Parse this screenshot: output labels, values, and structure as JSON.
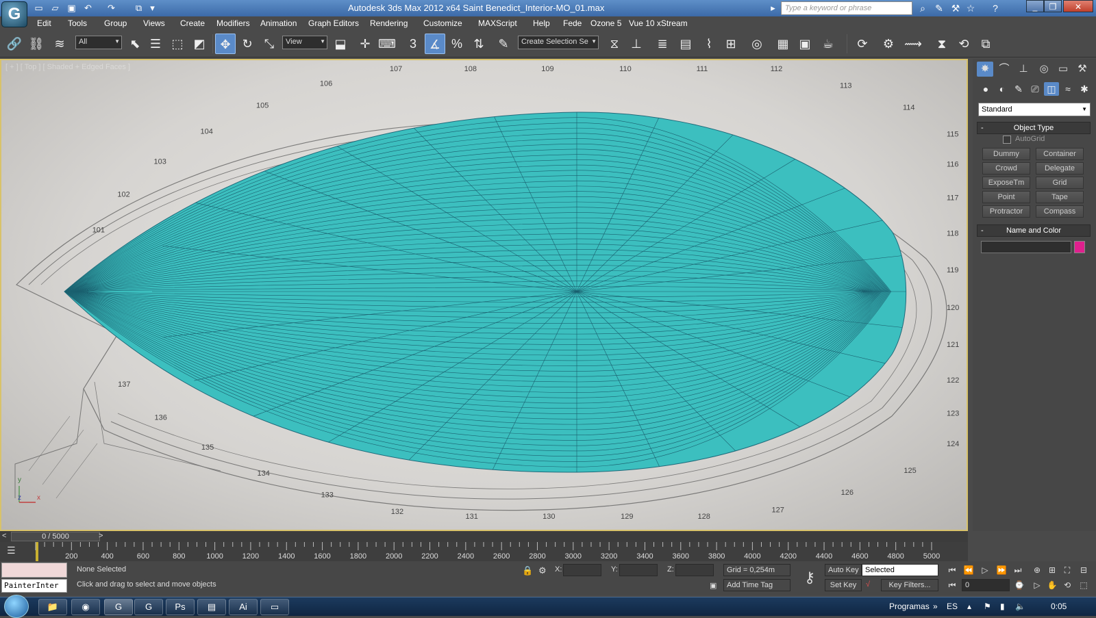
{
  "titlebar": {
    "title": "Autodesk 3ds Max  2012 x64     Saint Benedict_Interior-MO_01.max",
    "search_placeholder": "Type a keyword or phrase"
  },
  "menu": [
    "Edit",
    "Tools",
    "Group",
    "Views",
    "Create",
    "Modifiers",
    "Animation",
    "Graph Editors",
    "Rendering",
    "Customize",
    "MAXScript",
    "Help",
    "Fede",
    "Ozone 5",
    "Vue 10 xStream"
  ],
  "toolbar": {
    "selection_filter": "All",
    "ref_coord": "View",
    "named_selection": "Create Selection Se",
    "snap_label": "3"
  },
  "viewport": {
    "label": "[ + ] [ Top ] [ Shaded + Edged Faces ]",
    "axis_x": "x",
    "axis_y": "y",
    "axis_z": "z",
    "drawing_numbers": [
      "101",
      "102",
      "103",
      "104",
      "105",
      "106",
      "107",
      "108",
      "109",
      "110",
      "111",
      "112",
      "113",
      "114",
      "115",
      "116",
      "117",
      "118",
      "119",
      "120",
      "121",
      "122",
      "123",
      "124",
      "125",
      "126",
      "127",
      "128",
      "129",
      "130",
      "131",
      "132",
      "133",
      "134",
      "135",
      "136",
      "137"
    ],
    "mesh_color": "#3cbfbf"
  },
  "command_panel": {
    "category": "Standard",
    "object_type_title": "Object Type",
    "autogrid_label": "AutoGrid",
    "buttons": [
      "Dummy",
      "Container",
      "Crowd",
      "Delegate",
      "ExposeTm",
      "Grid",
      "Point",
      "Tape",
      "Protractor",
      "Compass"
    ],
    "name_color_title": "Name and Color",
    "object_color": "#e0208e"
  },
  "timeline": {
    "slider_text": "0 / 5000",
    "ticks": [
      "200",
      "400",
      "600",
      "800",
      "1000",
      "1200",
      "1400",
      "1600",
      "1800",
      "2000",
      "2200",
      "2400",
      "2600",
      "2800",
      "3000",
      "3200",
      "3400",
      "3600",
      "3800",
      "4000",
      "4200",
      "4400",
      "4600",
      "4800",
      "5000"
    ]
  },
  "status": {
    "listener": "PainterInter",
    "selection": "None Selected",
    "prompt": "Click and drag to select and move objects",
    "x_label": "X:",
    "y_label": "Y:",
    "z_label": "Z:",
    "grid": "Grid = 0,254m",
    "add_time_tag": "Add Time Tag",
    "auto_key": "Auto Key",
    "set_key": "Set Key",
    "key_mode": "Selected",
    "key_filters": "Key Filters...",
    "frame": "0"
  },
  "taskbar": {
    "programs": "Programas",
    "lang": "ES",
    "time": "0:05"
  }
}
